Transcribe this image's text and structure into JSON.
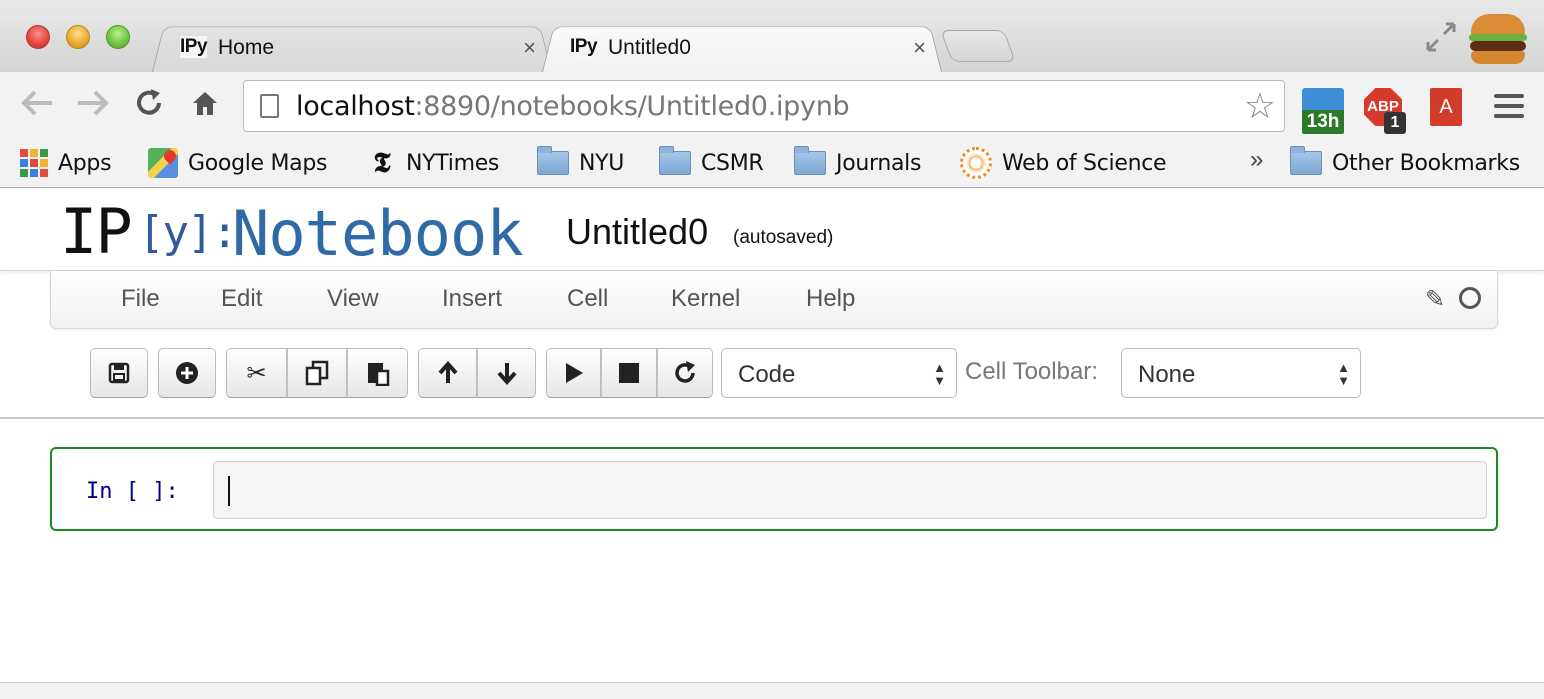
{
  "browser": {
    "tabs": [
      {
        "favicon": "IPy",
        "title": "Home",
        "close": "×"
      },
      {
        "favicon": "IPy",
        "title": "Untitled0",
        "close": "×"
      }
    ],
    "nav": {
      "back": "back-arrow-icon",
      "forward": "forward-arrow-icon",
      "reload": "reload-icon",
      "home": "home-icon"
    },
    "address": {
      "host": "localhost",
      "path": ":8890/notebooks/Untitled0.ipynb"
    },
    "extensions": {
      "calendar_badge": "13h",
      "abp_label": "ABP",
      "abp_badge": "1",
      "pdf_glyph": "A"
    },
    "bookmarks": [
      {
        "label": "Apps",
        "icon": "apps-grid-icon"
      },
      {
        "label": "Google Maps",
        "icon": "google-maps-icon"
      },
      {
        "label": "NYTimes",
        "icon": "nytimes-icon"
      },
      {
        "label": "NYU",
        "icon": "folder-icon"
      },
      {
        "label": "CSMR",
        "icon": "folder-icon"
      },
      {
        "label": "Journals",
        "icon": "folder-icon"
      },
      {
        "label": "Web of Science",
        "icon": "web-of-science-icon"
      }
    ],
    "overflow": "»",
    "other_bookmarks": "Other Bookmarks"
  },
  "notebook": {
    "logo_ip": "IP",
    "logo_y": "[y]:",
    "logo_notebook": "Notebook",
    "name": "Untitled0",
    "save_status": "(autosaved)",
    "menu": [
      "File",
      "Edit",
      "View",
      "Insert",
      "Cell",
      "Kernel",
      "Help"
    ],
    "toolbar": {
      "cell_type": "Code",
      "cell_toolbar_label": "Cell Toolbar:",
      "cell_toolbar_value": "None"
    },
    "cell": {
      "prompt": "In [ ]:",
      "content": ""
    }
  },
  "colors": {
    "accent_logo": "#2f6aa6",
    "cell_border": "#1d8a1d",
    "prompt": "#000080"
  }
}
